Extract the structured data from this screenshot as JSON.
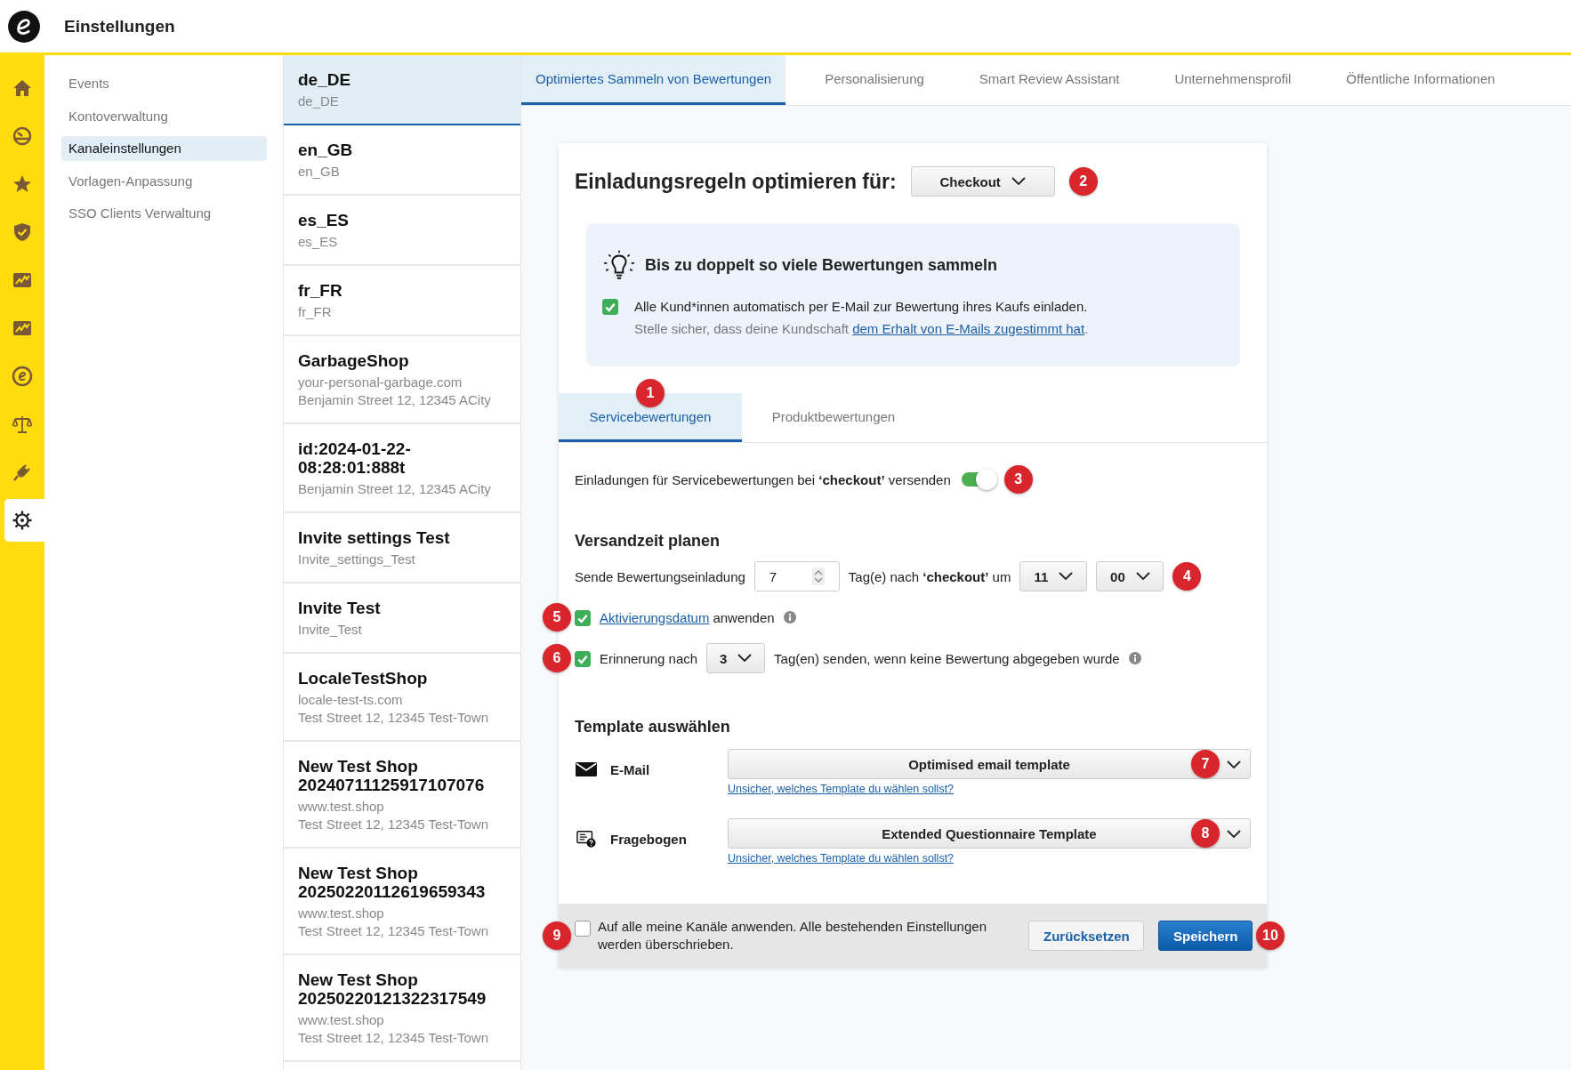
{
  "header": {
    "title": "Einstellungen"
  },
  "rail": [
    {
      "kind": "home",
      "selected": false
    },
    {
      "kind": "gauge",
      "selected": false
    },
    {
      "kind": "star",
      "selected": false
    },
    {
      "kind": "shield",
      "selected": false
    },
    {
      "kind": "chart",
      "selected": false
    },
    {
      "kind": "chart",
      "selected": false
    },
    {
      "kind": "logo",
      "selected": false
    },
    {
      "kind": "scales",
      "selected": false
    },
    {
      "kind": "plug",
      "selected": false
    },
    {
      "kind": "gear",
      "selected": true
    }
  ],
  "nav": [
    {
      "label": "Events",
      "selected": false
    },
    {
      "label": "Kontoverwaltung",
      "selected": false
    },
    {
      "label": "Kanaleinstellungen",
      "selected": true
    },
    {
      "label": "Vorlagen-Anpassung",
      "selected": false
    },
    {
      "label": "SSO Clients Verwaltung",
      "selected": false
    }
  ],
  "channels": [
    {
      "name": "de_DE",
      "lines": [
        "de_DE"
      ],
      "selected": true
    },
    {
      "name": "en_GB",
      "lines": [
        "en_GB"
      ],
      "selected": false
    },
    {
      "name": "es_ES",
      "lines": [
        "es_ES"
      ],
      "selected": false
    },
    {
      "name": "fr_FR",
      "lines": [
        "fr_FR"
      ],
      "selected": false
    },
    {
      "name": "GarbageShop",
      "lines": [
        "your-personal-garbage.com",
        "Benjamin Street 12, 12345 ACity"
      ],
      "selected": false
    },
    {
      "name": "id:2024-01-22-08:28:01:888t",
      "lines": [
        "Benjamin Street 12, 12345 ACity"
      ],
      "selected": false
    },
    {
      "name": "Invite settings Test",
      "lines": [
        "Invite_settings_Test"
      ],
      "selected": false
    },
    {
      "name": "Invite Test",
      "lines": [
        "Invite_Test"
      ],
      "selected": false
    },
    {
      "name": "LocaleTestShop",
      "lines": [
        "locale-test-ts.com",
        "Test Street 12, 12345 Test-Town"
      ],
      "selected": false
    },
    {
      "name": "New Test Shop 20240711125917107076",
      "lines": [
        "www.test.shop",
        "Test Street 12, 12345 Test-Town"
      ],
      "selected": false
    },
    {
      "name": "New Test Shop 20250220112619659343",
      "lines": [
        "www.test.shop",
        "Test Street 12, 12345 Test-Town"
      ],
      "selected": false
    },
    {
      "name": "New Test Shop 20250220121322317549",
      "lines": [
        "www.test.shop",
        "Test Street 12, 12345 Test-Town"
      ],
      "selected": false
    }
  ],
  "tabs": [
    {
      "label": "Optimiertes Sammeln von Bewertungen",
      "selected": true
    },
    {
      "label": "Personalisierung",
      "selected": false
    },
    {
      "label": "Smart Review Assistant",
      "selected": false
    },
    {
      "label": "Unternehmensprofil",
      "selected": false
    },
    {
      "label": "Öffentliche Informationen",
      "selected": false
    }
  ],
  "card": {
    "title": "Einladungsregeln optimieren für:",
    "trigger": {
      "value": "Checkout",
      "badge": "2"
    },
    "promo": {
      "title": "Bis zu doppelt so viele Bewertungen sammeln",
      "checked": true,
      "text": "Alle Kund*innen automatisch per E-Mail zur Bewertung ihres Kaufs einladen.",
      "note": "Stelle sicher, dass deine Kundschaft",
      "link": "dem Erhalt von E-Mails zugestimmt hat",
      "note_end": "."
    },
    "subtabs": [
      {
        "label": "Servicebewertungen",
        "selected": true,
        "badge": "1"
      },
      {
        "label": "Produktbewertungen",
        "selected": false
      }
    ],
    "toggle_row": {
      "text": "Einladungen für Servicebewertungen bei **‘checkout’** versenden",
      "on": true,
      "badge": "3"
    },
    "schedule": {
      "heading": "Versandzeit planen",
      "label": "Sende Bewertungseinladung",
      "days": "7",
      "after": "Tag(e) nach **‘checkout’** um",
      "hour": "11",
      "minute": "00",
      "badge": "4"
    },
    "activation": {
      "checked": true,
      "link": "Aktivierungsdatum",
      "text": "anwenden",
      "badge": "5"
    },
    "reminder": {
      "checked": true,
      "label": "Erinnerung nach",
      "days": "3",
      "text": "Tag(en) senden, wenn keine Bewertung abgegeben wurde",
      "badge": "6"
    },
    "templates": {
      "heading": "Template auswählen",
      "items": [
        {
          "kind": "email",
          "label": "E-Mail",
          "value": "Optimised email template",
          "help": "Unsicher, welches Template du wählen sollst?",
          "badge": "7"
        },
        {
          "kind": "questionnaire",
          "label": "Fragebogen",
          "value": "Extended Questionnaire Template",
          "help": "Unsicher, welches Template du wählen sollst?",
          "badge": "8"
        }
      ]
    },
    "footer": {
      "checked": false,
      "text": "Auf alle meine Kanäle anwenden. Alle bestehenden Einstellungen werden überschrieben.",
      "badge": "9",
      "reset": "Zurücksetzen",
      "save": "Speichern",
      "save_badge": "10"
    }
  }
}
